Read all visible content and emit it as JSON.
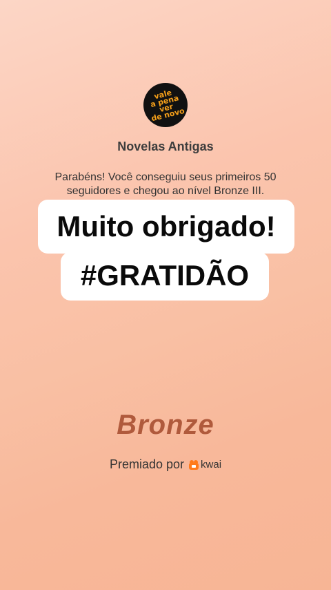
{
  "logo": {
    "text_lines": [
      "vale",
      "a pena",
      "ver",
      "de novo"
    ]
  },
  "channel": {
    "name": "Novelas Antigas"
  },
  "message": {
    "text": "Parabéns! Você conseguiu seus primeiros 50 seguidores e chegou ao nível Bronze III."
  },
  "sticker": {
    "line1": "Muito obrigado!",
    "line2": "#GRATIDÃO"
  },
  "badge": {
    "level": "Bronze"
  },
  "footer": {
    "awarded_by": "Premiado por",
    "brand": "kwai"
  },
  "colors": {
    "level": "#b05a3c",
    "logo_bg": "#111111",
    "logo_text": "#f6a01a",
    "kwai_icon": "#ff7a1a"
  }
}
